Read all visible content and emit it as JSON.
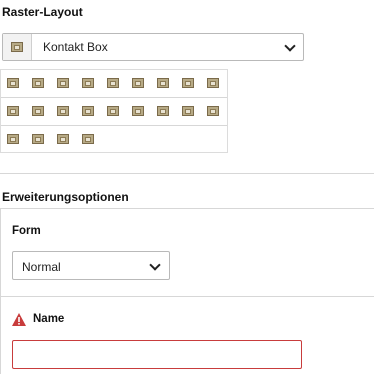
{
  "raster": {
    "heading": "Raster-Layout",
    "select_value": "Kontakt Box",
    "icon_rows": [
      9,
      9,
      4
    ]
  },
  "extensions": {
    "heading": "Erweiterungsoptionen",
    "form_label": "Form",
    "form_select_value": "Normal",
    "name_label": "Name",
    "name_value": ""
  },
  "colors": {
    "warning": "#c83c3c",
    "invalid_border": "#c83c3c"
  }
}
